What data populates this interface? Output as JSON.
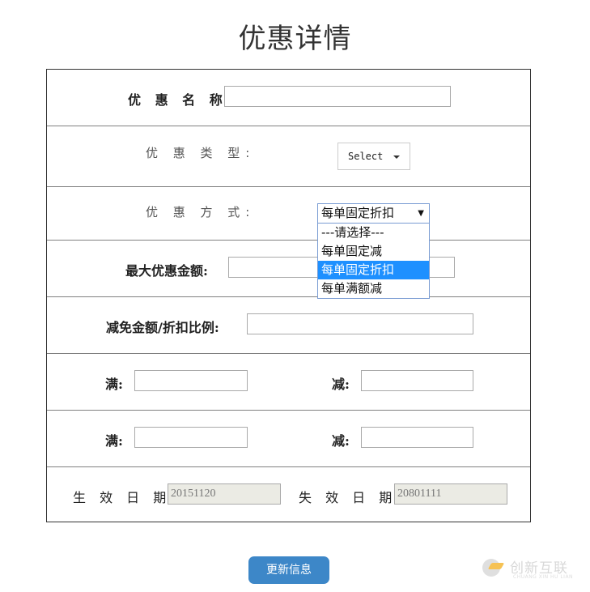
{
  "page": {
    "title": "优惠详情"
  },
  "form": {
    "name": {
      "label": "优 惠 名 称:",
      "value": "",
      "placeholder": ""
    },
    "type": {
      "label": "优 惠 类 型:",
      "button_label": "Select"
    },
    "method": {
      "label": "优 惠 方 式:",
      "selected": "每单固定折扣",
      "options": [
        "---请选择---",
        "每单固定减",
        "每单固定折扣",
        "每单满额减"
      ],
      "highlighted_index": 2
    },
    "max_amount": {
      "label": "最大优惠金额:",
      "value": ""
    },
    "discount": {
      "label": "减免金额/折扣比例:",
      "value": ""
    },
    "tiers": [
      {
        "full_label": "满:",
        "full_value": "",
        "minus_label": "减:",
        "minus_value": ""
      },
      {
        "full_label": "满:",
        "full_value": "",
        "minus_label": "减:",
        "minus_value": ""
      }
    ],
    "dates": {
      "start_label": "生 效 日 期:",
      "start_value": "20151120",
      "end_label": "失 效 日 期:",
      "end_value": "20801111"
    }
  },
  "actions": {
    "update_label": "更新信息"
  },
  "watermark": {
    "text": "创新互联",
    "subtext": "CHUANG XIN HU LIAN"
  }
}
